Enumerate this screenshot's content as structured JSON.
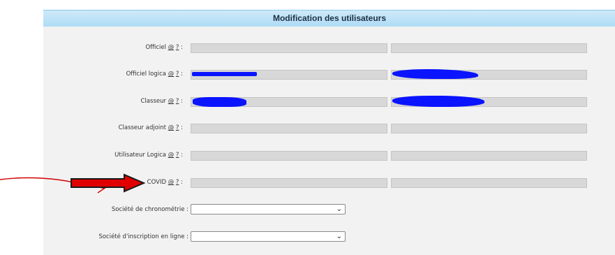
{
  "header": {
    "title": "Modification des utilisateurs"
  },
  "rows": [
    {
      "label": "Officiel",
      "links": [
        "@",
        "?"
      ],
      "suffix": " :"
    },
    {
      "label": "Officiel logica",
      "links": [
        "@",
        "?"
      ],
      "suffix": " :"
    },
    {
      "label": "Classeur",
      "links": [
        "@",
        "?"
      ],
      "suffix": " :"
    },
    {
      "label": "Classeur adjoint",
      "links": [
        "@",
        "?"
      ],
      "suffix": " :"
    },
    {
      "label": "Utilisateur Logica",
      "links": [
        "@",
        "?"
      ],
      "suffix": " :"
    },
    {
      "label": "COVID",
      "links": [
        "@",
        "?"
      ],
      "suffix": " :"
    }
  ],
  "selects": [
    {
      "label": "Société de chronométrie :",
      "value": "",
      "chevron": "⌄"
    },
    {
      "label": "Société d'inscription en ligne :",
      "value": "",
      "chevron": "⌄"
    }
  ],
  "colors": {
    "redaction": "#0a14ff",
    "arrow_fill": "#e00000",
    "arrow_line": "#d10000",
    "titlebar": "#aedcf5"
  }
}
